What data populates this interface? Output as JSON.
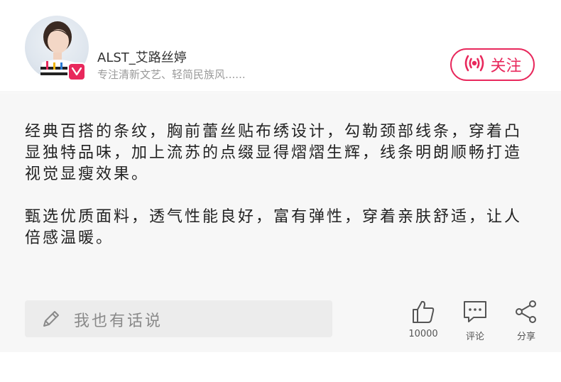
{
  "profile": {
    "username": "ALST_艾路丝婷",
    "bio": "专注清新文艺、轻简民族风......"
  },
  "follow": {
    "label": "关注",
    "color": "#e8285c"
  },
  "article": {
    "paragraphs": [
      "经典百搭的条纹，胸前蕾丝贴布绣设计，勾勒颈部线条，穿着凸显独特品味，加上流苏的点缀显得熠熠生辉，线条明朗顺畅打造视觉显瘦效果。",
      "甄选优质面料，透气性能良好，富有弹性，穿着亲肤舒适，让人倍感温暖。"
    ]
  },
  "comment_input": {
    "placeholder": "我也有话说"
  },
  "actions": {
    "like_count": "10000",
    "comment_label": "评论",
    "share_label": "分享"
  },
  "icons": {
    "badge": "v-badge-icon",
    "follow": "live-broadcast-icon",
    "pen": "pencil-icon",
    "like": "thumbs-up-icon",
    "comment": "comment-bubble-icon",
    "share": "share-icon"
  }
}
